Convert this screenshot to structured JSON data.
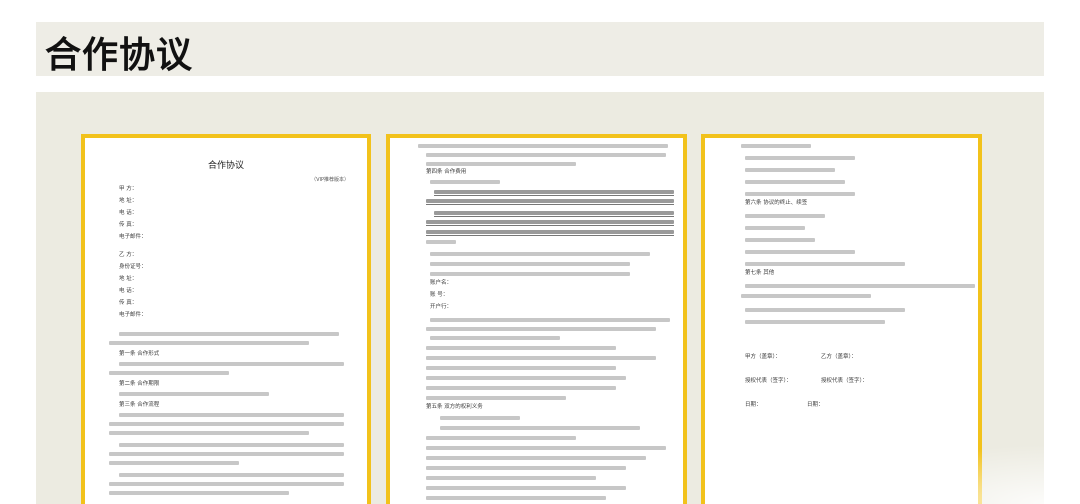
{
  "header": {
    "title": "合作协议"
  },
  "pages": [
    {
      "doc_title": "合作协议",
      "tag": "（VIP推荐版本）",
      "party_a_fields": [
        "甲 方：",
        "地 址：",
        "电 话：",
        "传 真：",
        "电子邮件："
      ],
      "party_b_fields": [
        "乙 方：",
        "身份证号：",
        "地 址：",
        "电 话：",
        "传 真：",
        "电子邮件："
      ],
      "sections": [
        "第一条 合作形式",
        "第二条 合作期限",
        "第三条 合作流程"
      ]
    },
    {
      "sections": [
        "第四条 合作费用",
        "第五条 双方的权利义务"
      ],
      "account_fields": [
        "账户名：",
        "账 号：",
        "开户行："
      ]
    },
    {
      "sections": [
        "第六条 协议的终止、续签",
        "第七条 其他"
      ],
      "signature_left": [
        "甲方（盖章）：",
        "授权代表（签字）：",
        "日期："
      ],
      "signature_right": [
        "乙方（盖章）：",
        "授权代表（签字）：",
        "日期："
      ]
    }
  ]
}
